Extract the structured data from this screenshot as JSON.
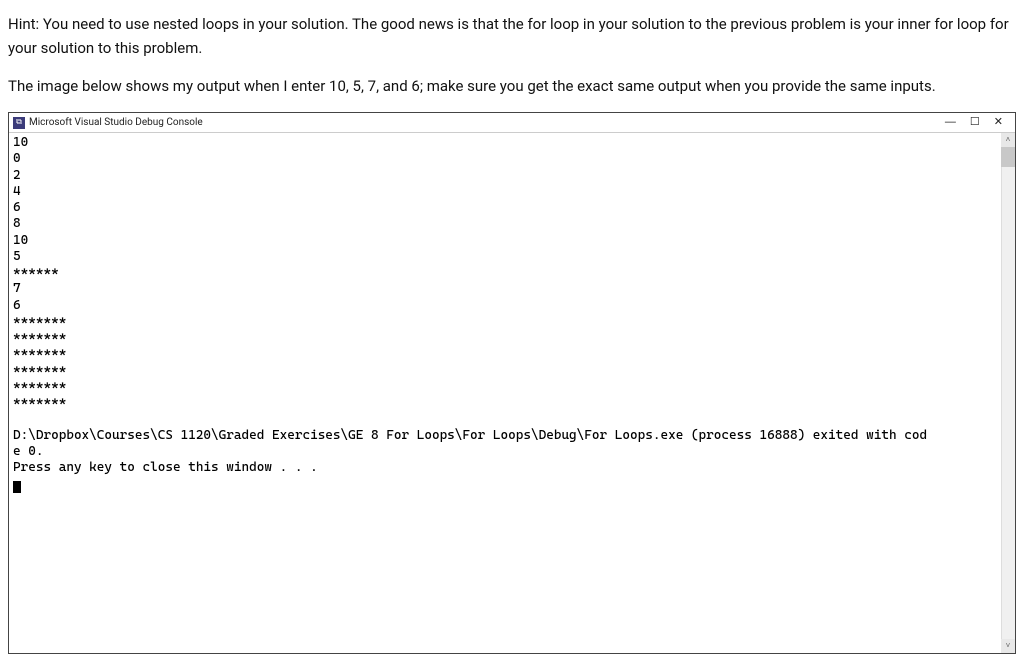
{
  "hint_text": "Hint: You need to use nested loops in your solution. The good news is that the for loop in your solution to the previous problem is your inner for loop for your solution to this problem.",
  "instruction_text": "The image below shows my output when I enter 10, 5, 7, and 6; make sure you get the exact same output when you provide the same inputs.",
  "titlebar": {
    "icon_glyph": "⧉",
    "title": "Microsoft Visual Studio Debug Console"
  },
  "win_controls": {
    "minimize": "—",
    "maximize": "☐",
    "close": "✕"
  },
  "console_lines": [
    "10",
    "0",
    "2",
    "4",
    "6",
    "8",
    "10",
    "5",
    "******",
    "7",
    "6",
    "*******",
    "*******",
    "*******",
    "*******",
    "*******",
    "*******",
    "",
    "D:\\Dropbox\\Courses\\CS 1120\\Graded Exercises\\GE 8 For Loops\\For Loops\\Debug\\For Loops.exe (process 16888) exited with cod",
    "e 0.",
    "Press any key to close this window . . ."
  ],
  "scrollbar": {
    "up_glyph": "˄",
    "down_glyph": "˅"
  }
}
